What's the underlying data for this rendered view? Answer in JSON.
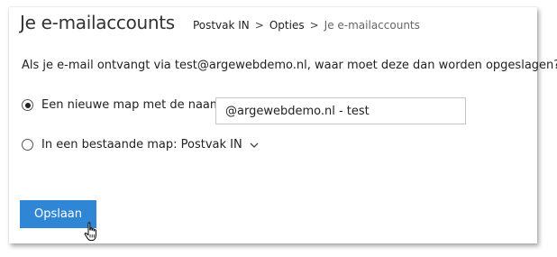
{
  "header": {
    "title": "Je e-mailaccounts",
    "breadcrumb": [
      "Postvak IN",
      "Opties",
      "Je e-mailaccounts"
    ],
    "separator": ">"
  },
  "question": "Als je e-mail ontvangt via test@argewebdemo.nl, waar moet deze dan worden opgeslagen?",
  "options": {
    "new_folder": {
      "label": "Een nieuwe map met de naam:",
      "selected": true,
      "input_value": "@argewebdemo.nl - test"
    },
    "existing_folder": {
      "label": "In een bestaande map: Postvak IN",
      "selected": false
    }
  },
  "actions": {
    "save_label": "Opslaan"
  },
  "icons": {
    "chevron": "chevron-down-icon",
    "cursor": "hand-pointer-icon"
  },
  "colors": {
    "accent": "#2f86d4"
  }
}
